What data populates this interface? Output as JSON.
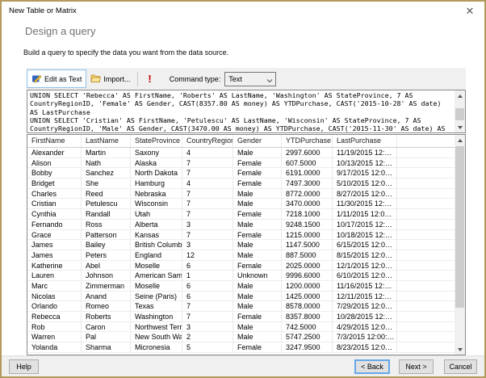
{
  "window": {
    "title": "New Table or Matrix",
    "close_glyph": "✕"
  },
  "header": {
    "title": "Design a query",
    "subtitle": "Build a query to specify the data you want from the data source."
  },
  "toolbar": {
    "edit_as_text_label": "Edit as Text",
    "import_label": "Import...",
    "run_glyph": "!",
    "command_type_label": "Command type:",
    "command_type_value": "Text"
  },
  "query": {
    "text": "UNION SELECT 'Rebecca' AS FirstName, 'Roberts' AS LastName, 'Washington' AS StateProvince, 7 AS\nCountryRegionID, 'Female' AS Gender, CAST(8357.80 AS money) AS YTDPurchase, CAST('2015-10-28' AS date)\nAS LastPurchase\nUNION SELECT 'Cristian' AS FirstName, 'Petulescu' AS LastName, 'Wisconsin' AS StateProvince, 7 AS\nCountryRegionID, 'Male' AS Gender, CAST(3470.00 AS money) AS YTDPurchase, CAST('2015-11-30' AS date) AS"
  },
  "grid": {
    "columns": [
      "FirstName",
      "LastName",
      "StateProvince",
      "CountryRegionID",
      "Gender",
      "YTDPurchase",
      "LastPurchase"
    ],
    "rows": [
      [
        "Alexander",
        "Martin",
        "Saxony",
        "4",
        "Male",
        "2997.6000",
        "11/19/2015 12:…"
      ],
      [
        "Alison",
        "Nath",
        "Alaska",
        "7",
        "Female",
        "607.5000",
        "10/13/2015 12:…"
      ],
      [
        "Bobby",
        "Sanchez",
        "North Dakota",
        "7",
        "Female",
        "6191.0000",
        "9/17/2015 12:0…"
      ],
      [
        "Bridget",
        "She",
        "Hamburg",
        "4",
        "Female",
        "7497.3000",
        "5/10/2015 12:0…"
      ],
      [
        "Charles",
        "Reed",
        "Nebraska",
        "7",
        "Male",
        "8772.0000",
        "8/27/2015 12:0…"
      ],
      [
        "Cristian",
        "Petulescu",
        "Wisconsin",
        "7",
        "Male",
        "3470.0000",
        "11/30/2015 12:…"
      ],
      [
        "Cynthia",
        "Randall",
        "Utah",
        "7",
        "Female",
        "7218.1000",
        "1/11/2015 12:0…"
      ],
      [
        "Fernando",
        "Ross",
        "Alberta",
        "3",
        "Male",
        "9248.1500",
        "10/17/2015 12:…"
      ],
      [
        "Grace",
        "Patterson",
        "Kansas",
        "7",
        "Female",
        "1215.0000",
        "10/18/2015 12:…"
      ],
      [
        "James",
        "Bailey",
        "British Columbia",
        "3",
        "Male",
        "1147.5000",
        "6/15/2015 12:0…"
      ],
      [
        "James",
        "Peters",
        "England",
        "12",
        "Male",
        "887.5000",
        "8/15/2015 12:0…"
      ],
      [
        "Katherine",
        "Abel",
        "Moselle",
        "6",
        "Female",
        "2025.0000",
        "12/1/2015 12:0…"
      ],
      [
        "Lauren",
        "Johnson",
        "American Samoa",
        "1",
        "Unknown",
        "9996.6000",
        "6/10/2015 12:0…"
      ],
      [
        "Marc",
        "Zimmerman",
        "Moselle",
        "6",
        "Male",
        "1200.0000",
        "11/16/2015 12:…"
      ],
      [
        "Nicolas",
        "Anand",
        "Seine (Paris)",
        "6",
        "Male",
        "1425.0000",
        "12/11/2015 12:…"
      ],
      [
        "Orlando",
        "Romeo",
        "Texas",
        "7",
        "Male",
        "8578.0000",
        "7/29/2015 12:0…"
      ],
      [
        "Rebecca",
        "Roberts",
        "Washington",
        "7",
        "Female",
        "8357.8000",
        "10/28/2015 12:…"
      ],
      [
        "Rob",
        "Caron",
        "Northwest Terri…",
        "3",
        "Male",
        "742.5000",
        "4/29/2015 12:0…"
      ],
      [
        "Warren",
        "Pal",
        "New South Wales",
        "2",
        "Male",
        "5747.2500",
        "7/3/2015 12:00:…"
      ],
      [
        "Yolanda",
        "Sharma",
        "Micronesia",
        "5",
        "Female",
        "3247.9500",
        "8/23/2015 12:0…"
      ]
    ]
  },
  "footer": {
    "help_label": "Help",
    "back_label": "< Back",
    "next_label": "Next >",
    "cancel_label": "Cancel"
  }
}
